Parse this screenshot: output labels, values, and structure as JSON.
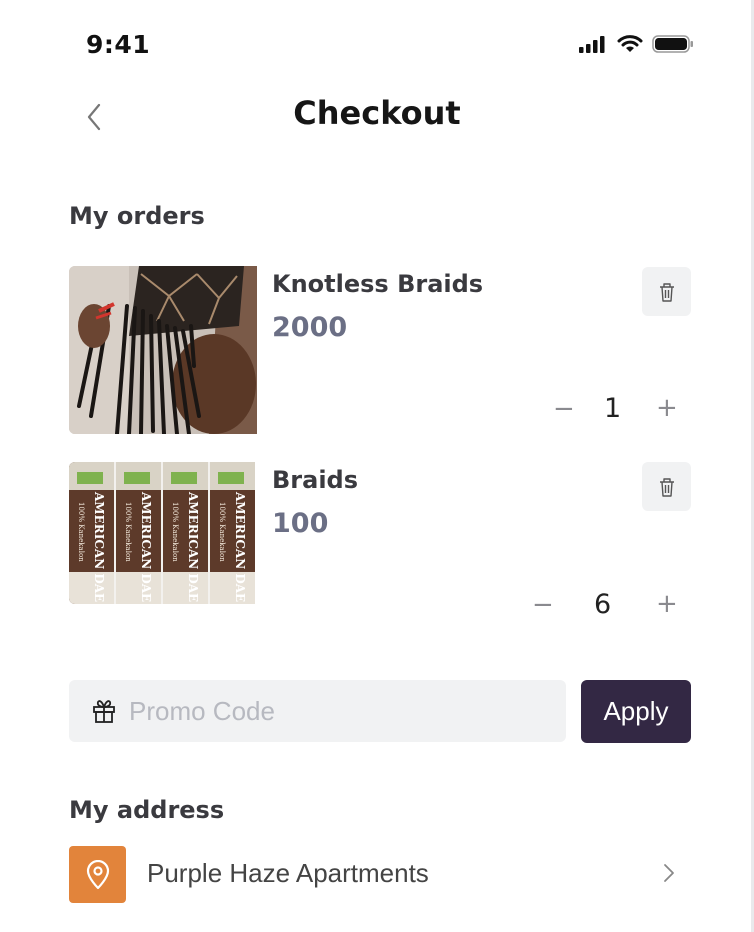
{
  "status_bar": {
    "time": "9:41"
  },
  "header": {
    "title": "Checkout"
  },
  "orders_section": {
    "title": "My orders"
  },
  "orders": [
    {
      "name": "Knotless Braids",
      "price": "2000",
      "quantity": "1"
    },
    {
      "name": "Braids",
      "price": "100",
      "quantity": "6"
    }
  ],
  "product_packaging_text": {
    "brand": "AMERICAN DAE",
    "tagline": "100% Kanekalon"
  },
  "quantity_controls": {
    "decrease": "−",
    "increase": "+"
  },
  "promo": {
    "placeholder": "Promo Code",
    "apply_label": "Apply"
  },
  "address_section": {
    "title": "My address",
    "address": "Purple Haze Apartments"
  },
  "colors": {
    "primary_button": "#332844",
    "location_accent": "#e2843b",
    "price_text": "#6b6f85"
  },
  "icons": [
    "signal-icon",
    "wifi-icon",
    "battery-icon",
    "back-chevron-icon",
    "trash-icon",
    "gift-icon",
    "location-pin-icon",
    "chevron-right-icon"
  ]
}
